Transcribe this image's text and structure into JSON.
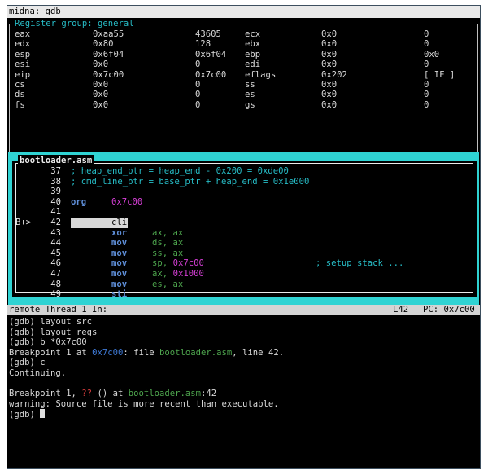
{
  "window_title": "midna: gdb",
  "registers": {
    "group_label": "Register group: general",
    "rows": [
      [
        "eax",
        "0xaa55",
        "43605",
        "ecx",
        "0x0",
        "0"
      ],
      [
        "edx",
        "0x80",
        "128",
        "ebx",
        "0x0",
        "0"
      ],
      [
        "esp",
        "0x6f04",
        "0x6f04",
        "ebp",
        "0x0",
        "0x0"
      ],
      [
        "esi",
        "0x0",
        "0",
        "edi",
        "0x0",
        "0"
      ],
      [
        "eip",
        "0x7c00",
        "0x7c00",
        "eflags",
        "0x202",
        "[ IF ]"
      ],
      [
        "cs",
        "0x0",
        "0",
        "ss",
        "0x0",
        "0"
      ],
      [
        "ds",
        "0x0",
        "0",
        "es",
        "0x0",
        "0"
      ],
      [
        "fs",
        "0x0",
        "0",
        "gs",
        "0x0",
        "0"
      ]
    ]
  },
  "source": {
    "file": "bootloader.asm",
    "lines": [
      {
        "n": "37",
        "mark": "",
        "parts": [
          [
            "; heap_end_ptr = heap_end - 0x200 = 0xde00",
            "cmt"
          ]
        ]
      },
      {
        "n": "38",
        "mark": "",
        "parts": [
          [
            "; cmd_line_ptr = base_ptr + heap_end = 0x1e000",
            "cmt"
          ]
        ]
      },
      {
        "n": "39",
        "mark": "",
        "parts": []
      },
      {
        "n": "40",
        "mark": "",
        "parts": [
          [
            "org",
            "kw"
          ],
          [
            "0x7c00",
            "mag"
          ]
        ]
      },
      {
        "n": "41",
        "mark": "",
        "parts": []
      },
      {
        "n": "42",
        "mark": "B+>",
        "parts": [
          [
            "cli",
            "kw"
          ]
        ],
        "current": true
      },
      {
        "n": "43",
        "mark": "",
        "parts": [
          [
            "xor",
            "kw"
          ],
          [
            "ax, ax",
            "grn"
          ]
        ]
      },
      {
        "n": "44",
        "mark": "",
        "parts": [
          [
            "mov",
            "kw"
          ],
          [
            "ds, ax",
            "grn"
          ]
        ]
      },
      {
        "n": "45",
        "mark": "",
        "parts": [
          [
            "mov",
            "kw"
          ],
          [
            "ss, ax",
            "grn"
          ]
        ]
      },
      {
        "n": "46",
        "mark": "",
        "parts": [
          [
            "mov",
            "kw"
          ],
          [
            "sp, ",
            "grn"
          ],
          [
            "0x7c00",
            "mag"
          ],
          [
            "; setup stack ...",
            "cmt"
          ]
        ]
      },
      {
        "n": "47",
        "mark": "",
        "parts": [
          [
            "mov",
            "kw"
          ],
          [
            "ax, ",
            "grn"
          ],
          [
            "0x1000",
            "mag"
          ]
        ]
      },
      {
        "n": "48",
        "mark": "",
        "parts": [
          [
            "mov",
            "kw"
          ],
          [
            "es, ax",
            "grn"
          ]
        ]
      },
      {
        "n": "49",
        "mark": "",
        "parts": [
          [
            "sti",
            "kw"
          ]
        ]
      }
    ]
  },
  "status": {
    "thread": "remote Thread 1 In:",
    "line": "L42",
    "pc": "PC: 0x7c00"
  },
  "console": {
    "lines": [
      [
        [
          "(gdb) layout src",
          ""
        ]
      ],
      [
        [
          "(gdb) layout regs",
          ""
        ]
      ],
      [
        [
          "(gdb) b *0x7c00",
          ""
        ]
      ],
      [
        [
          "Breakpoint 1 at ",
          ""
        ],
        [
          "0x7c00",
          "blue"
        ],
        [
          ": file ",
          ""
        ],
        [
          "bootloader.asm",
          "green"
        ],
        [
          ", line 42.",
          ""
        ]
      ],
      [
        [
          "(gdb) c",
          ""
        ]
      ],
      [
        [
          "Continuing.",
          ""
        ]
      ],
      [
        [
          "",
          ""
        ]
      ],
      [
        [
          "Breakpoint 1, ",
          ""
        ],
        [
          "??",
          "red"
        ],
        [
          " () at ",
          ""
        ],
        [
          "bootloader.asm",
          "green"
        ],
        [
          ":42",
          ""
        ]
      ],
      [
        [
          "warning: Source file is more recent than executable.",
          ""
        ]
      ]
    ],
    "prompt": "(gdb) "
  }
}
